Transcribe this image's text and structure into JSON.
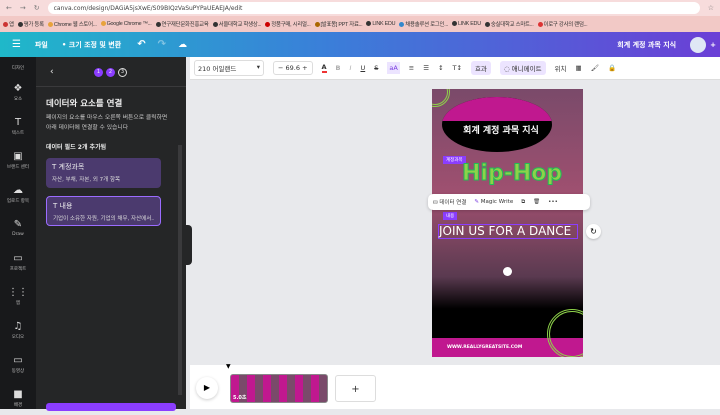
{
  "browser": {
    "url": "canva.com/design/DAGiA5jsXwE/S09BIQzVaSuPYPaUEAEJA/edit",
    "bookmarks": [
      "앱",
      "평가 등록",
      "Chrome 웹 스토어...",
      "Google Chrome ™...",
      "연구재단문화진흥교육",
      "서울대학교 학생상...",
      "정품구매, 시리얼...",
      "[발표몽] PPT 자료...",
      "LINK EDU",
      "채용솔루션 로그인...",
      "LINK EDU",
      "숭실대학교 스마트...",
      "이로구 강사의 랜덤..."
    ]
  },
  "header": {
    "file": "파일",
    "resize": "크기 조정 및 변환",
    "title": "회계 계정 과목 지식"
  },
  "rail": {
    "top": "디자인",
    "items": [
      "요소",
      "텍스트",
      "브랜드 센터",
      "업로드 항목",
      "Draw",
      "프로젝트",
      "앱",
      "오디오",
      "동영상",
      "배경"
    ]
  },
  "panel": {
    "steps": [
      "1",
      "2",
      "3"
    ],
    "title": "데이터와 요소를 연결",
    "desc": "페이지의 요소를 마우스 오른쪽 버튼으로 클릭하면 아래 데이터에 연결할 수 있습니다",
    "fields_label": "데이터 필드 2개 추가됨",
    "fields": [
      {
        "name": "계정과목",
        "preview": "자산, 부채, 자본, 외 7개 항목"
      },
      {
        "name": "내용",
        "preview": "기업이 소유한 자원, 기업의 채무, 자산에서..."
      }
    ]
  },
  "toolbar": {
    "font": "210 어일랜드",
    "size": "69.6",
    "effects": "효과",
    "animate": "애니메이트",
    "position": "위치"
  },
  "design": {
    "title": "회계 계정 과목 지식",
    "tag1": "계정과목",
    "headline": "Hip-Hop",
    "tag2": "내용",
    "body": "JOIN US FOR A DANCE",
    "footer": "WWW.REALLYGREATSITE.COM"
  },
  "context_menu": {
    "connect": "데이터 연결",
    "magic": "Magic Write"
  },
  "timeline": {
    "duration": "5.0초",
    "add": "+"
  }
}
